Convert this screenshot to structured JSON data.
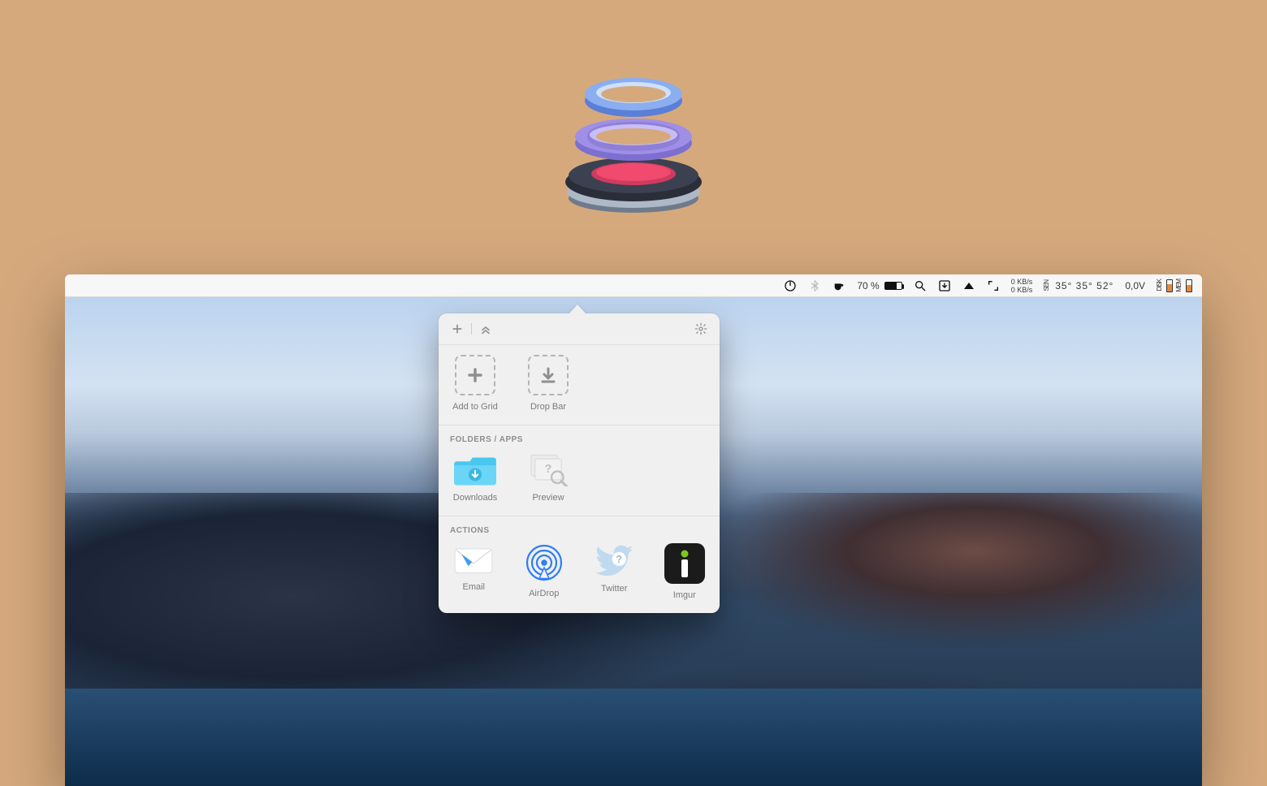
{
  "menubar": {
    "battery_percent": "70 %",
    "net_down": "0 KB/s",
    "net_up": "0 KB/s",
    "sensor_label": "SEN",
    "temps": "35° 35° 52°",
    "voltage": "0,0V",
    "disk_label": "DISK",
    "mem_label": "MEM"
  },
  "popover": {
    "top": {
      "add_to_grid": "Add to Grid",
      "drop_bar": "Drop Bar"
    },
    "folders_title": "FOLDERS / APPS",
    "folders": {
      "downloads": "Downloads",
      "preview": "Preview"
    },
    "actions_title": "ACTIONS",
    "actions": {
      "email": "Email",
      "airdrop": "AirDrop",
      "twitter": "Twitter",
      "imgur": "Imgur"
    }
  }
}
